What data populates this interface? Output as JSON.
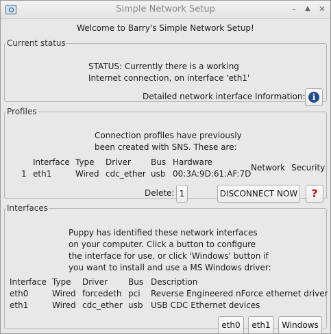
{
  "window": {
    "title": "Simple Network Setup"
  },
  "welcome": "Welcome to Barry's Simple Network Setup!",
  "status": {
    "legend": "Current status",
    "line1": "STATUS: Currently there is a working",
    "line2": "Internet connection, on interface 'eth1'",
    "detail_label": "Detailed network interface Information:",
    "info_icon_glyph": "i"
  },
  "profiles": {
    "legend": "Profiles",
    "line1": "Connection profiles have previously",
    "line2": "been created with SNS. These are:",
    "headers": [
      "Interface",
      "Type",
      "Driver",
      "Bus",
      "Hardware",
      "Network",
      "Security"
    ],
    "rows": [
      {
        "num": "1",
        "interface": "eth1",
        "type": "Wired",
        "driver": "cdc_ether",
        "bus": "usb",
        "hardware": "00:3A:9D:61:AF:7D"
      }
    ],
    "delete_label": "Delete:",
    "delete_value": "1",
    "disconnect_label": "DISCONNECT NOW",
    "help_glyph": "?"
  },
  "interfaces": {
    "legend": "Interfaces",
    "line1": "Puppy has identified these network interfaces",
    "line2": "on your computer. Click a button to configure",
    "line3": "the interface for use, or click 'Windows' button if",
    "line4": "you want to install and use a MS Windows driver:",
    "headers": [
      "Interface",
      "Type",
      "Driver",
      "Bus",
      "Description"
    ],
    "rows": [
      {
        "interface": "eth0",
        "type": "Wired",
        "driver": "forcedeth",
        "bus": "pci",
        "description": "Reverse Engineered nForce ethernet driver"
      },
      {
        "interface": "eth1",
        "type": "Wired",
        "driver": "cdc_ether",
        "bus": "usb",
        "description": "USB CDC Ethernet devices"
      }
    ],
    "buttons": [
      "eth0",
      "eth1",
      "Windows"
    ]
  }
}
